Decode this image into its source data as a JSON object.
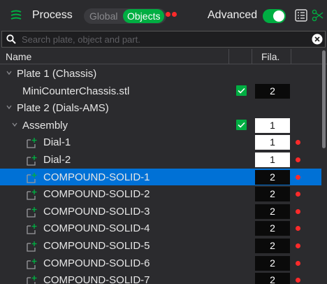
{
  "header": {
    "process_label": "Process",
    "scope_global": "Global",
    "scope_objects": "Objects",
    "advanced_label": "Advanced",
    "advanced_on": true,
    "accent_color": "#00ae42",
    "icons": [
      "process-icon",
      "list-icon",
      "scissors-icon"
    ]
  },
  "search": {
    "placeholder": "Search plate, object and part.",
    "value": ""
  },
  "table": {
    "col_name": "Name",
    "col_fila": "Fila.",
    "rows": [
      {
        "label": "Plate 1 (Chassis)",
        "level": 0,
        "expandable": true,
        "checked": false,
        "fila": "",
        "error": false,
        "selected": false,
        "part": false
      },
      {
        "label": "MiniCounterChassis.stl",
        "level": 1,
        "expandable": false,
        "checked": true,
        "fila": "2",
        "fila_style": "black",
        "error": false,
        "selected": false,
        "part": false
      },
      {
        "label": "Plate 2 (Dials-AMS)",
        "level": 0,
        "expandable": true,
        "checked": false,
        "fila": "",
        "error": false,
        "selected": false,
        "part": false
      },
      {
        "label": "Assembly",
        "level": 1,
        "expandable": true,
        "checked": true,
        "fila": "1",
        "fila_style": "white",
        "error": false,
        "selected": false,
        "part": false
      },
      {
        "label": "Dial-1",
        "level": 2,
        "expandable": false,
        "checked": false,
        "fila": "1",
        "fila_style": "white",
        "error": true,
        "selected": false,
        "part": true
      },
      {
        "label": "Dial-2",
        "level": 2,
        "expandable": false,
        "checked": false,
        "fila": "1",
        "fila_style": "white",
        "error": true,
        "selected": false,
        "part": true
      },
      {
        "label": "COMPOUND-SOLID-1",
        "level": 2,
        "expandable": false,
        "checked": false,
        "fila": "2",
        "fila_style": "black",
        "error": true,
        "selected": true,
        "part": true
      },
      {
        "label": "COMPOUND-SOLID-2",
        "level": 2,
        "expandable": false,
        "checked": false,
        "fila": "2",
        "fila_style": "black",
        "error": true,
        "selected": false,
        "part": true
      },
      {
        "label": "COMPOUND-SOLID-3",
        "level": 2,
        "expandable": false,
        "checked": false,
        "fila": "2",
        "fila_style": "black",
        "error": true,
        "selected": false,
        "part": true
      },
      {
        "label": "COMPOUND-SOLID-4",
        "level": 2,
        "expandable": false,
        "checked": false,
        "fila": "2",
        "fila_style": "black",
        "error": true,
        "selected": false,
        "part": true
      },
      {
        "label": "COMPOUND-SOLID-5",
        "level": 2,
        "expandable": false,
        "checked": false,
        "fila": "2",
        "fila_style": "black",
        "error": true,
        "selected": false,
        "part": true
      },
      {
        "label": "COMPOUND-SOLID-6",
        "level": 2,
        "expandable": false,
        "checked": false,
        "fila": "2",
        "fila_style": "black",
        "error": true,
        "selected": false,
        "part": true
      },
      {
        "label": "COMPOUND-SOLID-7",
        "level": 2,
        "expandable": false,
        "checked": false,
        "fila": "2",
        "fila_style": "black",
        "error": true,
        "selected": false,
        "part": true
      }
    ]
  }
}
